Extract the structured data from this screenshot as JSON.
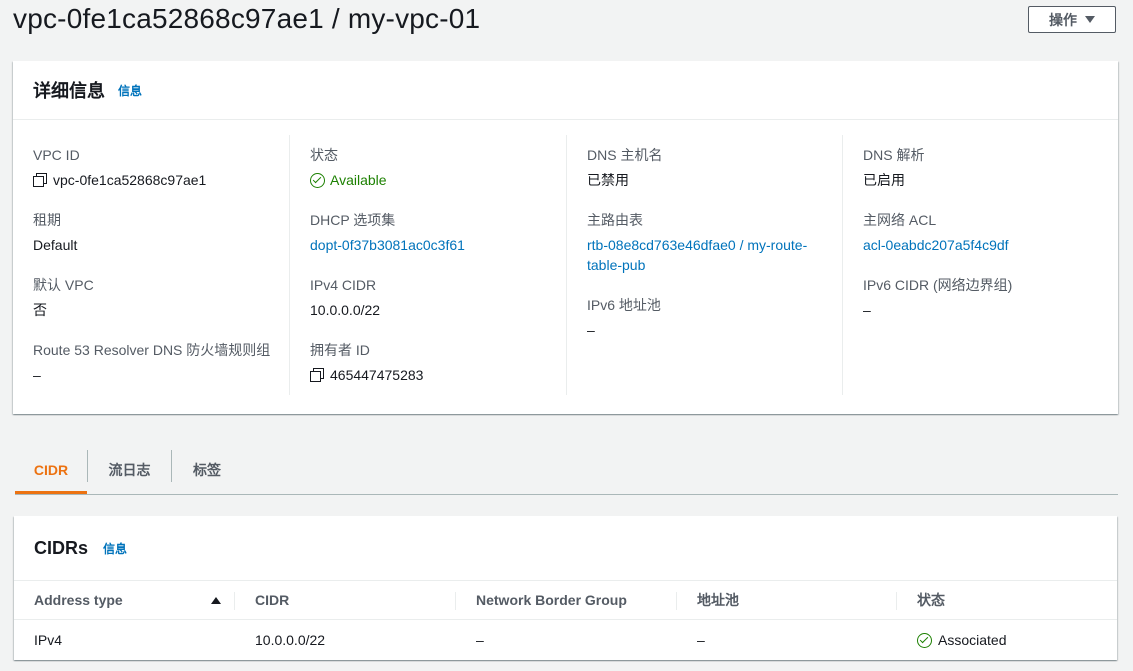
{
  "header": {
    "title": "vpc-0fe1ca52868c97ae1 / my-vpc-01",
    "actions_label": "操作"
  },
  "details": {
    "title": "详细信息",
    "info_label": "信息",
    "vpc_id": {
      "label": "VPC ID",
      "value": "vpc-0fe1ca52868c97ae1"
    },
    "tenancy": {
      "label": "租期",
      "value": "Default"
    },
    "default_vpc": {
      "label": "默认 VPC",
      "value": "否"
    },
    "resolver": {
      "label": "Route 53 Resolver DNS 防火墙规则组",
      "value": "–"
    },
    "state": {
      "label": "状态",
      "value": "Available"
    },
    "dhcp": {
      "label": "DHCP 选项集",
      "value": "dopt-0f37b3081ac0c3f61"
    },
    "ipv4_cidr": {
      "label": "IPv4 CIDR",
      "value": "10.0.0.0/22"
    },
    "owner": {
      "label": "拥有者 ID",
      "value": "465447475283"
    },
    "dns_hostnames": {
      "label": "DNS 主机名",
      "value": "已禁用"
    },
    "main_route_table": {
      "label": "主路由表",
      "value_line1": "rtb-08e8cd763e46dfae0 / my-route-",
      "value_line2": "table-pub"
    },
    "ipv6_pool": {
      "label": "IPv6 地址池",
      "value": "–"
    },
    "dns_resolution": {
      "label": "DNS 解析",
      "value": "已启用"
    },
    "main_acl": {
      "label": "主网络 ACL",
      "value": "acl-0eabdc207a5f4c9df"
    },
    "ipv6_cidr": {
      "label": "IPv6 CIDR (网络边界组)",
      "value": "–"
    }
  },
  "tabs": [
    {
      "label": "CIDR",
      "active": true
    },
    {
      "label": "流日志",
      "active": false
    },
    {
      "label": "标签",
      "active": false
    }
  ],
  "cidrs": {
    "title": "CIDRs",
    "info_label": "信息",
    "columns": [
      "Address type",
      "CIDR",
      "Network Border Group",
      "地址池",
      "状态"
    ],
    "rows": [
      {
        "address_type": "IPv4",
        "cidr": "10.0.0.0/22",
        "nbg": "–",
        "pool": "–",
        "state": "Associated"
      }
    ]
  },
  "colors": {
    "accent": "#ec7211",
    "link": "#0073bb",
    "success": "#1d8102"
  }
}
